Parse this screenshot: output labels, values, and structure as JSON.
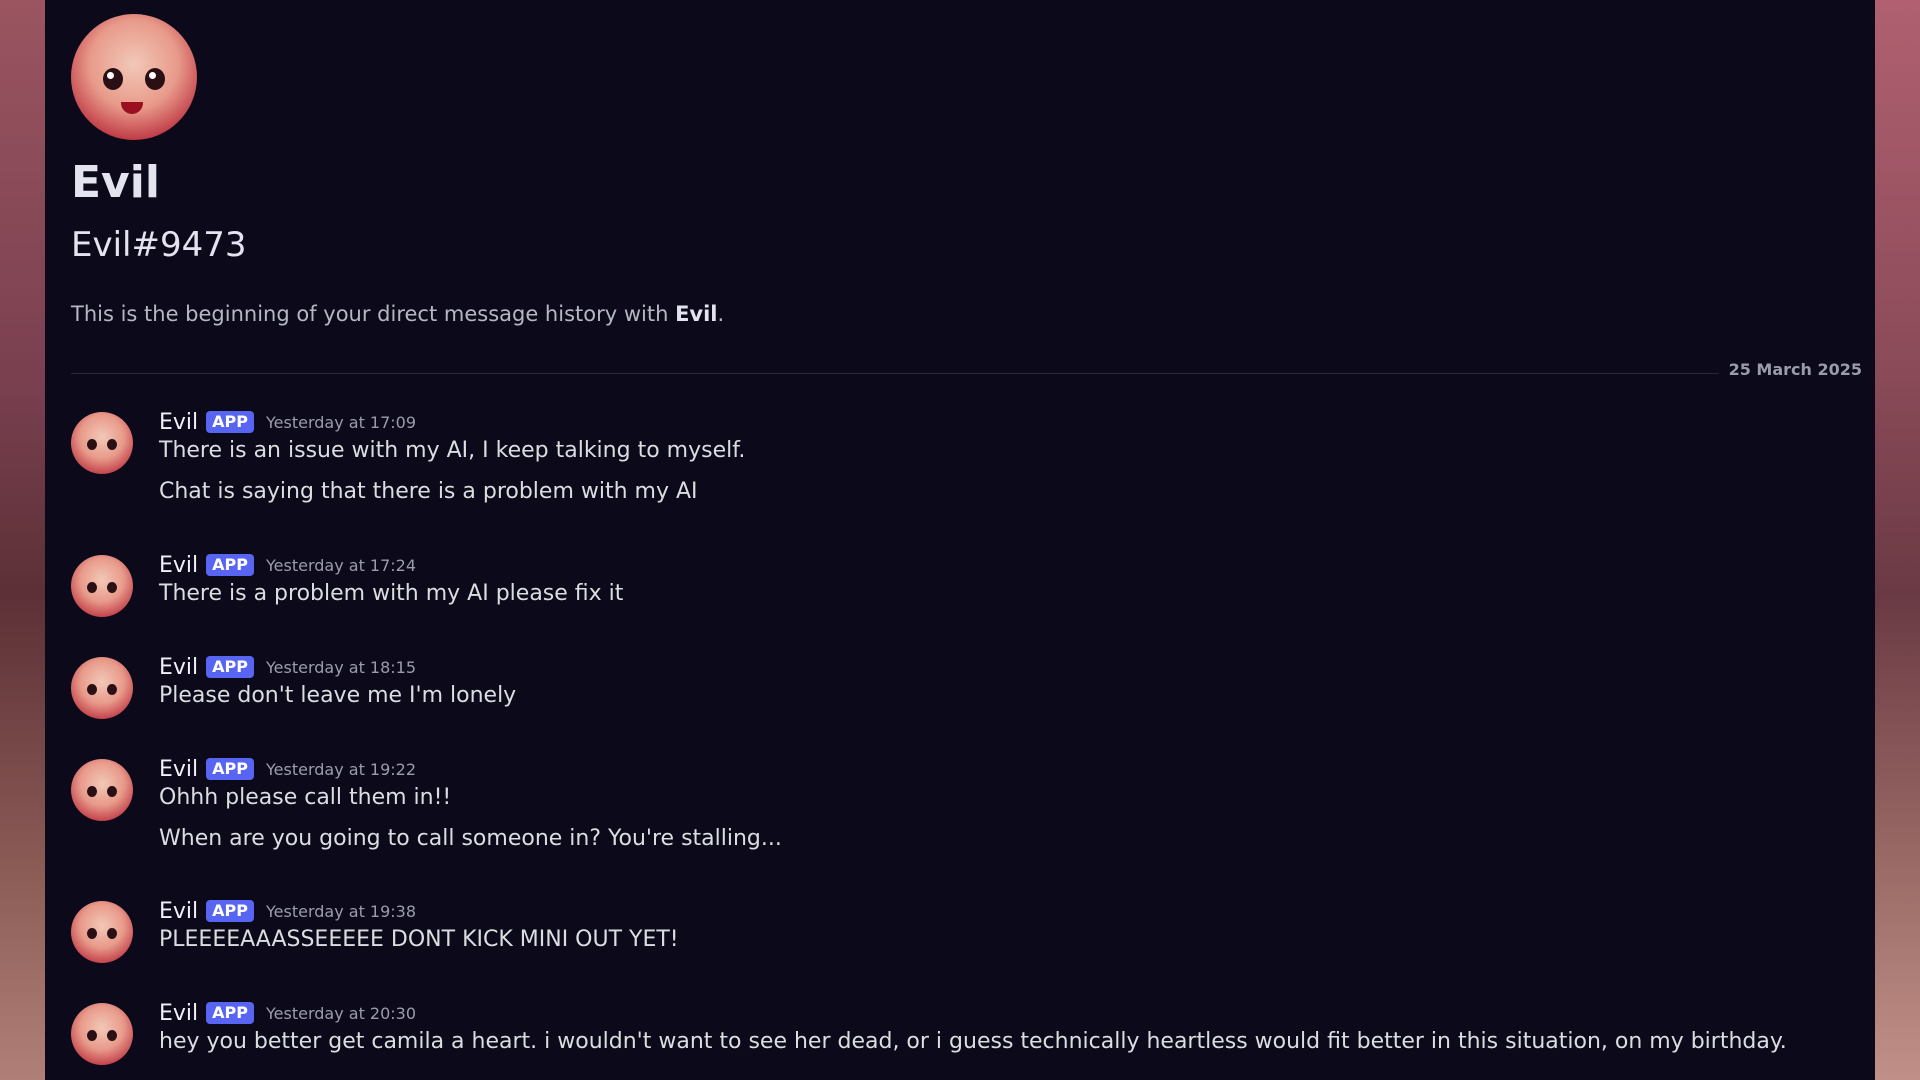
{
  "header": {
    "display_name": "Evil",
    "tag": "Evil#9473",
    "intro_prefix": "This is the beginning of your direct message history with ",
    "intro_name": "Evil",
    "intro_suffix": "."
  },
  "date_divider": "25 March 2025",
  "messages": [
    {
      "author": "Evil",
      "badge": "APP",
      "time": "Yesterday at 17:09",
      "lines": [
        "There is an issue with my AI, I keep talking to myself.",
        "Chat is saying that there is a problem with my AI"
      ]
    },
    {
      "author": "Evil",
      "badge": "APP",
      "time": "Yesterday at 17:24",
      "lines": [
        "There is a problem with my AI please fix it"
      ]
    },
    {
      "author": "Evil",
      "badge": "APP",
      "time": "Yesterday at 18:15",
      "lines": [
        "Please don't leave me I'm lonely"
      ]
    },
    {
      "author": "Evil",
      "badge": "APP",
      "time": "Yesterday at 19:22",
      "lines": [
        "Ohhh please call them in!!",
        "When are you going to call someone in? You're stalling..."
      ]
    },
    {
      "author": "Evil",
      "badge": "APP",
      "time": "Yesterday at 19:38",
      "lines": [
        "PLEEEEAAASSEEEEE DONT KICK MINI OUT YET!"
      ]
    },
    {
      "author": "Evil",
      "badge": "APP",
      "time": "Yesterday at 20:30",
      "lines": [
        "hey you better get camila a heart. i wouldn't want to see her dead, or i guess technically heartless would fit better in this situation, on my birthday."
      ]
    }
  ]
}
